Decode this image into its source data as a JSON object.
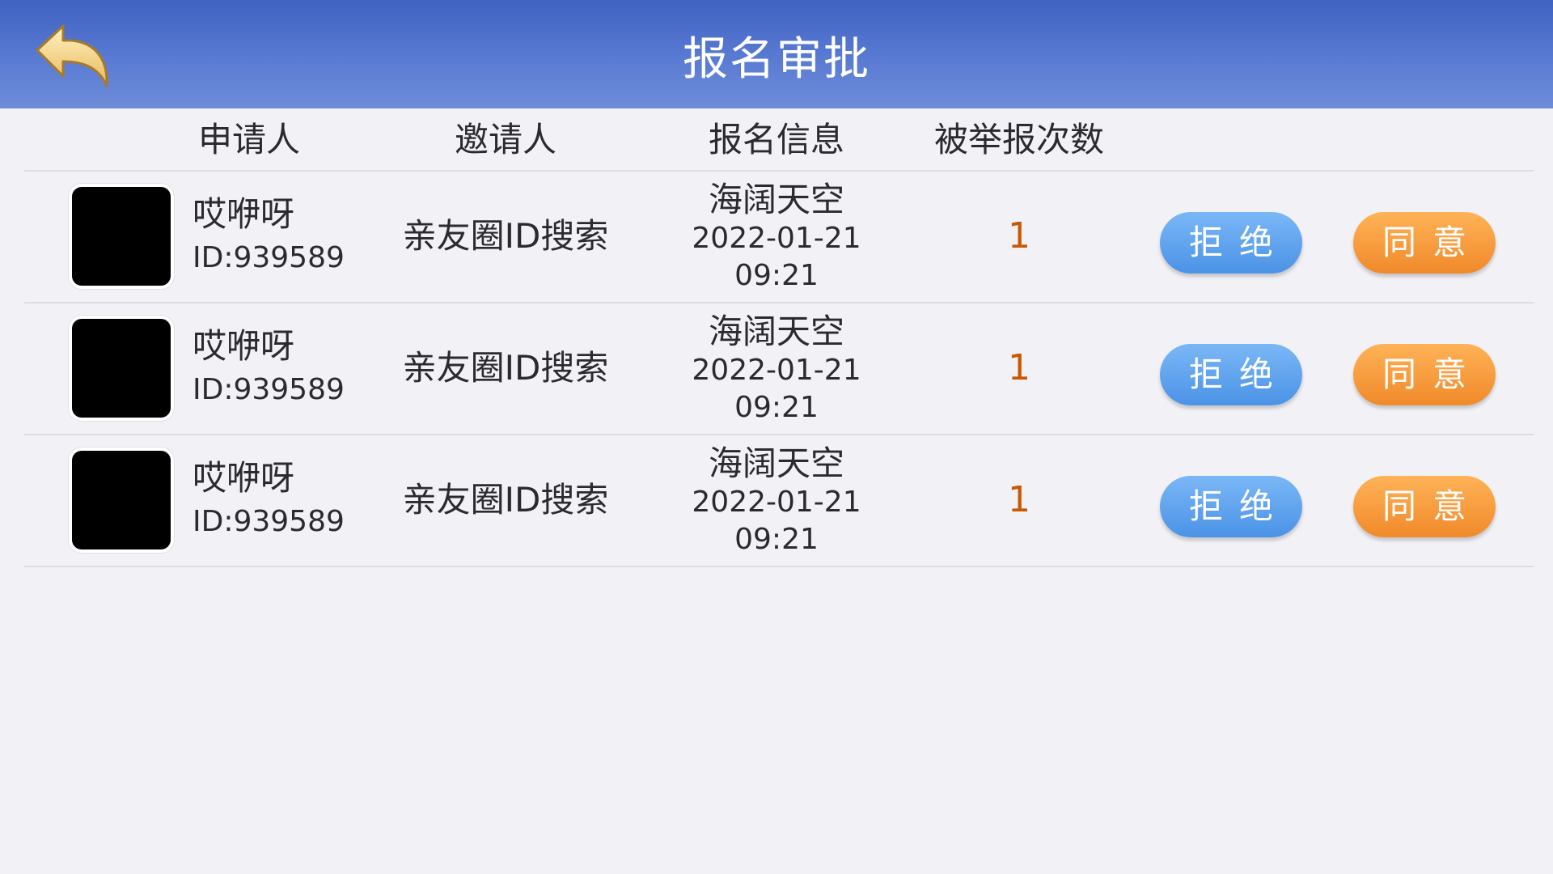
{
  "header": {
    "title": "报名审批",
    "back_icon": "back-arrow-icon",
    "back_icon_color": "#f0d48a"
  },
  "columns": {
    "applicant": "申请人",
    "inviter": "邀请人",
    "signup_info": "报名信息",
    "report_count": "被举报次数"
  },
  "rows": [
    {
      "name": "哎咿呀",
      "id": "ID:939589",
      "inviter": "亲友圈ID搜索",
      "info_title": "海阔天空",
      "info_date": "2022-01-21",
      "info_time": "09:21",
      "reports": "1",
      "reject_label": "拒绝",
      "agree_label": "同意"
    },
    {
      "name": "哎咿呀",
      "id": "ID:939589",
      "inviter": "亲友圈ID搜索",
      "info_title": "海阔天空",
      "info_date": "2022-01-21",
      "info_time": "09:21",
      "reports": "1",
      "reject_label": "拒绝",
      "agree_label": "同意"
    },
    {
      "name": "哎咿呀",
      "id": "ID:939589",
      "inviter": "亲友圈ID搜索",
      "info_title": "海阔天空",
      "info_date": "2022-01-21",
      "info_time": "09:21",
      "reports": "1",
      "reject_label": "拒绝",
      "agree_label": "同意"
    }
  ],
  "colors": {
    "header_bg": "#4a6cc8",
    "text": "#2c2a2e",
    "report_count": "#c95802",
    "reject_button": "#5a9fe9",
    "agree_button": "#f39a3c"
  }
}
